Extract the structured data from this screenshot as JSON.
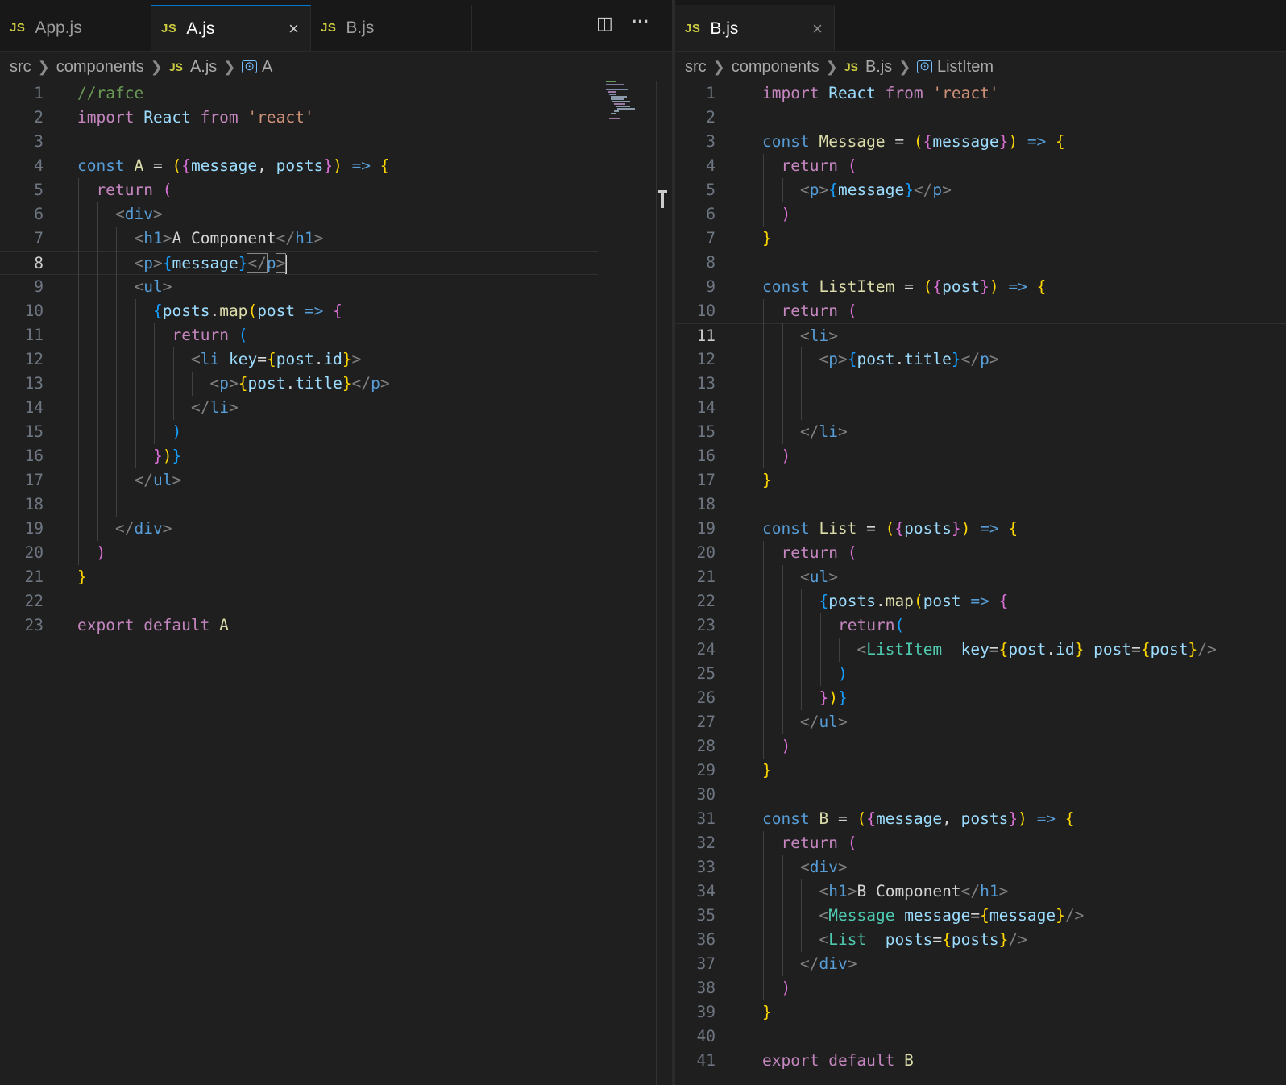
{
  "left_editor": {
    "tabs": [
      {
        "icon": "JS",
        "label": "App.js",
        "active": false
      },
      {
        "icon": "JS",
        "label": "A.js",
        "active": true
      },
      {
        "icon": "JS",
        "label": "B.js",
        "active": false
      }
    ],
    "close_glyph": "×",
    "split_glyph": "◫",
    "more_glyph": "···",
    "breadcrumb": {
      "folder1": "src",
      "folder2": "components",
      "file_icon": "JS",
      "file": "A.js",
      "symbol": "A"
    },
    "cursor_line": "8"
  },
  "right_editor": {
    "tabs": [
      {
        "icon": "JS",
        "label": "B.js",
        "active": true
      }
    ],
    "close_glyph": "×",
    "breadcrumb": {
      "folder1": "src",
      "folder2": "components",
      "file_icon": "JS",
      "file": "B.js",
      "symbol": "ListItem"
    },
    "cursor_line": "11"
  },
  "line_numbers": [
    "1",
    "2",
    "3",
    "4",
    "5",
    "6",
    "7",
    "8",
    "9",
    "10",
    "11",
    "12",
    "13",
    "14",
    "15",
    "16",
    "17",
    "18",
    "19",
    "20",
    "21",
    "22",
    "23",
    "24",
    "25",
    "26",
    "27",
    "28",
    "29",
    "30",
    "31",
    "32",
    "33",
    "34",
    "35",
    "36",
    "37",
    "38",
    "39",
    "40",
    "41"
  ],
  "code_a": [
    [
      [
        "cmt",
        "//rafce"
      ]
    ],
    [
      [
        "ctl",
        "import"
      ],
      [
        "plain",
        " "
      ],
      [
        "var",
        "React"
      ],
      [
        "plain",
        " "
      ],
      [
        "ctl",
        "from"
      ],
      [
        "plain",
        " "
      ],
      [
        "str",
        "'react'"
      ]
    ],
    [],
    [
      [
        "kw",
        "const"
      ],
      [
        "plain",
        " "
      ],
      [
        "fn",
        "A"
      ],
      [
        "plain",
        " = "
      ],
      [
        "b1",
        "("
      ],
      [
        "b2",
        "{"
      ],
      [
        "var",
        "message"
      ],
      [
        "plain",
        ", "
      ],
      [
        "var",
        "posts"
      ],
      [
        "b2",
        "}"
      ],
      [
        "b1",
        ")"
      ],
      [
        "plain",
        " "
      ],
      [
        "kw",
        "=>"
      ],
      [
        "plain",
        " "
      ],
      [
        "b1",
        "{"
      ]
    ],
    [
      [
        "ctl",
        "return"
      ],
      [
        "plain",
        " "
      ],
      [
        "b2",
        "("
      ]
    ],
    [
      [
        "brk",
        "<"
      ],
      [
        "tag",
        "div"
      ],
      [
        "brk",
        ">"
      ]
    ],
    [
      [
        "brk",
        "<"
      ],
      [
        "tag",
        "h1"
      ],
      [
        "brk",
        ">"
      ],
      [
        "plain",
        "A Component"
      ],
      [
        "brk",
        "</"
      ],
      [
        "tag",
        "h1"
      ],
      [
        "brk",
        ">"
      ]
    ],
    [
      [
        "brk",
        "<"
      ],
      [
        "tag",
        "p"
      ],
      [
        "brk",
        ">"
      ],
      [
        "b3",
        "{"
      ],
      [
        "var",
        "message"
      ],
      [
        "b3",
        "}"
      ],
      [
        "brk",
        "</"
      ],
      [
        "tag",
        "p"
      ],
      [
        "brk",
        ">"
      ]
    ],
    [
      [
        "brk",
        "<"
      ],
      [
        "tag",
        "ul"
      ],
      [
        "brk",
        ">"
      ]
    ],
    [
      [
        "b3",
        "{"
      ],
      [
        "var",
        "posts"
      ],
      [
        "plain",
        "."
      ],
      [
        "fn",
        "map"
      ],
      [
        "b1",
        "("
      ],
      [
        "var",
        "post"
      ],
      [
        "plain",
        " "
      ],
      [
        "kw",
        "=>"
      ],
      [
        "plain",
        " "
      ],
      [
        "b2",
        "{"
      ]
    ],
    [
      [
        "ctl",
        "return"
      ],
      [
        "plain",
        " "
      ],
      [
        "b3",
        "("
      ]
    ],
    [
      [
        "brk",
        "<"
      ],
      [
        "tag",
        "li"
      ],
      [
        "plain",
        " "
      ],
      [
        "attr",
        "key"
      ],
      [
        "plain",
        "="
      ],
      [
        "b1",
        "{"
      ],
      [
        "var",
        "post"
      ],
      [
        "plain",
        "."
      ],
      [
        "var",
        "id"
      ],
      [
        "b1",
        "}"
      ],
      [
        "brk",
        ">"
      ]
    ],
    [
      [
        "brk",
        "<"
      ],
      [
        "tag",
        "p"
      ],
      [
        "brk",
        ">"
      ],
      [
        "b1",
        "{"
      ],
      [
        "var",
        "post"
      ],
      [
        "plain",
        "."
      ],
      [
        "var",
        "title"
      ],
      [
        "b1",
        "}"
      ],
      [
        "brk",
        "</"
      ],
      [
        "tag",
        "p"
      ],
      [
        "brk",
        ">"
      ]
    ],
    [
      [
        "brk",
        "</"
      ],
      [
        "tag",
        "li"
      ],
      [
        "brk",
        ">"
      ]
    ],
    [
      [
        "b3",
        ")"
      ]
    ],
    [
      [
        "b2",
        "}"
      ],
      [
        "b1",
        ")"
      ],
      [
        "b3",
        "}"
      ]
    ],
    [
      [
        "brk",
        "</"
      ],
      [
        "tag",
        "ul"
      ],
      [
        "brk",
        ">"
      ]
    ],
    [],
    [
      [
        "brk",
        "</"
      ],
      [
        "tag",
        "div"
      ],
      [
        "brk",
        ">"
      ]
    ],
    [
      [
        "b2",
        ")"
      ]
    ],
    [
      [
        "b1",
        "}"
      ]
    ],
    [],
    [
      [
        "ctl",
        "export"
      ],
      [
        "plain",
        " "
      ],
      [
        "ctl",
        "default"
      ],
      [
        "plain",
        " "
      ],
      [
        "fn",
        "A"
      ]
    ]
  ],
  "code_b": [
    [
      [
        "ctl",
        "import"
      ],
      [
        "plain",
        " "
      ],
      [
        "var",
        "React"
      ],
      [
        "plain",
        " "
      ],
      [
        "ctl",
        "from"
      ],
      [
        "plain",
        " "
      ],
      [
        "str",
        "'react'"
      ]
    ],
    [],
    [
      [
        "kw",
        "const"
      ],
      [
        "plain",
        " "
      ],
      [
        "fn",
        "Message"
      ],
      [
        "plain",
        " = "
      ],
      [
        "b1",
        "("
      ],
      [
        "b2",
        "{"
      ],
      [
        "var",
        "message"
      ],
      [
        "b2",
        "}"
      ],
      [
        "b1",
        ")"
      ],
      [
        "plain",
        " "
      ],
      [
        "kw",
        "=>"
      ],
      [
        "plain",
        " "
      ],
      [
        "b1",
        "{"
      ]
    ],
    [
      [
        "ctl",
        "return"
      ],
      [
        "plain",
        " "
      ],
      [
        "b2",
        "("
      ]
    ],
    [
      [
        "brk",
        "<"
      ],
      [
        "tag",
        "p"
      ],
      [
        "brk",
        ">"
      ],
      [
        "b3",
        "{"
      ],
      [
        "var",
        "message"
      ],
      [
        "b3",
        "}"
      ],
      [
        "brk",
        "</"
      ],
      [
        "tag",
        "p"
      ],
      [
        "brk",
        ">"
      ]
    ],
    [
      [
        "b2",
        ")"
      ]
    ],
    [
      [
        "b1",
        "}"
      ]
    ],
    [],
    [
      [
        "kw",
        "const"
      ],
      [
        "plain",
        " "
      ],
      [
        "fn",
        "ListItem"
      ],
      [
        "plain",
        " = "
      ],
      [
        "b1",
        "("
      ],
      [
        "b2",
        "{"
      ],
      [
        "var",
        "post"
      ],
      [
        "b2",
        "}"
      ],
      [
        "b1",
        ")"
      ],
      [
        "plain",
        " "
      ],
      [
        "kw",
        "=>"
      ],
      [
        "plain",
        " "
      ],
      [
        "b1",
        "{"
      ]
    ],
    [
      [
        "ctl",
        "return"
      ],
      [
        "plain",
        " "
      ],
      [
        "b2",
        "("
      ]
    ],
    [
      [
        "brk",
        "<"
      ],
      [
        "tag",
        "li"
      ],
      [
        "brk",
        ">"
      ]
    ],
    [
      [
        "brk",
        "<"
      ],
      [
        "tag",
        "p"
      ],
      [
        "brk",
        ">"
      ],
      [
        "b3",
        "{"
      ],
      [
        "var",
        "post"
      ],
      [
        "plain",
        "."
      ],
      [
        "var",
        "title"
      ],
      [
        "b3",
        "}"
      ],
      [
        "brk",
        "</"
      ],
      [
        "tag",
        "p"
      ],
      [
        "brk",
        ">"
      ]
    ],
    [],
    [],
    [
      [
        "brk",
        "</"
      ],
      [
        "tag",
        "li"
      ],
      [
        "brk",
        ">"
      ]
    ],
    [
      [
        "b2",
        ")"
      ]
    ],
    [
      [
        "b1",
        "}"
      ]
    ],
    [],
    [
      [
        "kw",
        "const"
      ],
      [
        "plain",
        " "
      ],
      [
        "fn",
        "List"
      ],
      [
        "plain",
        " = "
      ],
      [
        "b1",
        "("
      ],
      [
        "b2",
        "{"
      ],
      [
        "var",
        "posts"
      ],
      [
        "b2",
        "}"
      ],
      [
        "b1",
        ")"
      ],
      [
        "plain",
        " "
      ],
      [
        "kw",
        "=>"
      ],
      [
        "plain",
        " "
      ],
      [
        "b1",
        "{"
      ]
    ],
    [
      [
        "ctl",
        "return"
      ],
      [
        "plain",
        " "
      ],
      [
        "b2",
        "("
      ]
    ],
    [
      [
        "brk",
        "<"
      ],
      [
        "tag",
        "ul"
      ],
      [
        "brk",
        ">"
      ]
    ],
    [
      [
        "b3",
        "{"
      ],
      [
        "var",
        "posts"
      ],
      [
        "plain",
        "."
      ],
      [
        "fn",
        "map"
      ],
      [
        "b1",
        "("
      ],
      [
        "var",
        "post"
      ],
      [
        "plain",
        " "
      ],
      [
        "kw",
        "=>"
      ],
      [
        "plain",
        " "
      ],
      [
        "b2",
        "{"
      ]
    ],
    [
      [
        "ctl",
        "return"
      ],
      [
        "b3",
        "("
      ]
    ],
    [
      [
        "brk",
        "<"
      ],
      [
        "cls",
        "ListItem"
      ],
      [
        "plain",
        "  "
      ],
      [
        "attr",
        "key"
      ],
      [
        "plain",
        "="
      ],
      [
        "b1",
        "{"
      ],
      [
        "var",
        "post"
      ],
      [
        "plain",
        "."
      ],
      [
        "var",
        "id"
      ],
      [
        "b1",
        "}"
      ],
      [
        "plain",
        " "
      ],
      [
        "attr",
        "post"
      ],
      [
        "plain",
        "="
      ],
      [
        "b1",
        "{"
      ],
      [
        "var",
        "post"
      ],
      [
        "b1",
        "}"
      ],
      [
        "brk",
        "/>"
      ]
    ],
    [
      [
        "b3",
        ")"
      ]
    ],
    [
      [
        "b2",
        "}"
      ],
      [
        "b1",
        ")"
      ],
      [
        "b3",
        "}"
      ]
    ],
    [
      [
        "brk",
        "</"
      ],
      [
        "tag",
        "ul"
      ],
      [
        "brk",
        ">"
      ]
    ],
    [
      [
        "b2",
        ")"
      ]
    ],
    [
      [
        "b1",
        "}"
      ]
    ],
    [],
    [
      [
        "kw",
        "const"
      ],
      [
        "plain",
        " "
      ],
      [
        "fn",
        "B"
      ],
      [
        "plain",
        " = "
      ],
      [
        "b1",
        "("
      ],
      [
        "b2",
        "{"
      ],
      [
        "var",
        "message"
      ],
      [
        "plain",
        ", "
      ],
      [
        "var",
        "posts"
      ],
      [
        "b2",
        "}"
      ],
      [
        "b1",
        ")"
      ],
      [
        "plain",
        " "
      ],
      [
        "kw",
        "=>"
      ],
      [
        "plain",
        " "
      ],
      [
        "b1",
        "{"
      ]
    ],
    [
      [
        "ctl",
        "return"
      ],
      [
        "plain",
        " "
      ],
      [
        "b2",
        "("
      ]
    ],
    [
      [
        "brk",
        "<"
      ],
      [
        "tag",
        "div"
      ],
      [
        "brk",
        ">"
      ]
    ],
    [
      [
        "brk",
        "<"
      ],
      [
        "tag",
        "h1"
      ],
      [
        "brk",
        ">"
      ],
      [
        "plain",
        "B Component"
      ],
      [
        "brk",
        "</"
      ],
      [
        "tag",
        "h1"
      ],
      [
        "brk",
        ">"
      ]
    ],
    [
      [
        "brk",
        "<"
      ],
      [
        "cls",
        "Message"
      ],
      [
        "plain",
        " "
      ],
      [
        "attr",
        "message"
      ],
      [
        "plain",
        "="
      ],
      [
        "b1",
        "{"
      ],
      [
        "var",
        "message"
      ],
      [
        "b1",
        "}"
      ],
      [
        "brk",
        "/>"
      ]
    ],
    [
      [
        "brk",
        "<"
      ],
      [
        "cls",
        "List"
      ],
      [
        "plain",
        "  "
      ],
      [
        "attr",
        "posts"
      ],
      [
        "plain",
        "="
      ],
      [
        "b1",
        "{"
      ],
      [
        "var",
        "posts"
      ],
      [
        "b1",
        "}"
      ],
      [
        "brk",
        "/>"
      ]
    ],
    [
      [
        "brk",
        "</"
      ],
      [
        "tag",
        "div"
      ],
      [
        "brk",
        ">"
      ]
    ],
    [
      [
        "b2",
        ")"
      ]
    ],
    [
      [
        "b1",
        "}"
      ]
    ],
    [],
    [
      [
        "ctl",
        "export"
      ],
      [
        "plain",
        " "
      ],
      [
        "ctl",
        "default"
      ],
      [
        "plain",
        " "
      ],
      [
        "fn",
        "B"
      ]
    ]
  ]
}
